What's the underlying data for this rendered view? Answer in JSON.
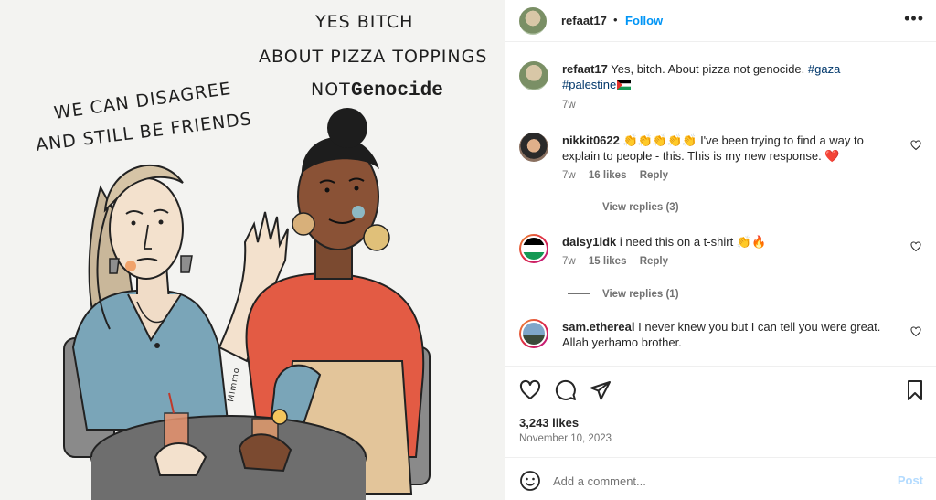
{
  "artwork": {
    "caption_left_line1": "WE CAN DISAGREE",
    "caption_left_line2": "AND STILL BE FRIENDS",
    "caption_right_line1": "YES BITCH",
    "caption_right_line2": "ABOUT PIZZA TOPPINGS",
    "caption_right_line3_a": "NOT",
    "caption_right_line3_b": "Genocide",
    "signature": "Mlmmo"
  },
  "header": {
    "username": "refaat17",
    "separator": "•",
    "follow_label": "Follow",
    "more_label": "•••"
  },
  "caption": {
    "username": "refaat17",
    "text": "Yes, bitch. About pizza not genocide.",
    "hashtag1": "#gaza",
    "hashtag2": "#palestine",
    "time": "7w"
  },
  "comments": [
    {
      "username": "nikkit0622",
      "emojis": "👏👏👏👏👏",
      "text": "I've been trying to find a way to explain to people - this. This is my new response.",
      "emoji_end": "❤️",
      "time": "7w",
      "likes": "16 likes",
      "reply": "Reply",
      "view_replies": "View replies (3)"
    },
    {
      "username": "daisy1ldk",
      "text": "i need this on a t-shirt",
      "emoji_end": "👏🔥",
      "time": "7w",
      "likes": "15 likes",
      "reply": "Reply",
      "view_replies": "View replies (1)"
    },
    {
      "username": "sam.ethereal",
      "text": "I never knew you but I can tell you were great. Allah yerhamo brother."
    }
  ],
  "actions": {
    "likes": "3,243 likes",
    "date": "November 10, 2023"
  },
  "add_comment": {
    "placeholder": "Add a comment...",
    "post_label": "Post"
  },
  "colors": {
    "link_blue": "#0095f6",
    "hashtag": "#00376b",
    "muted": "#737373",
    "post_disabled": "#b3dbff"
  }
}
